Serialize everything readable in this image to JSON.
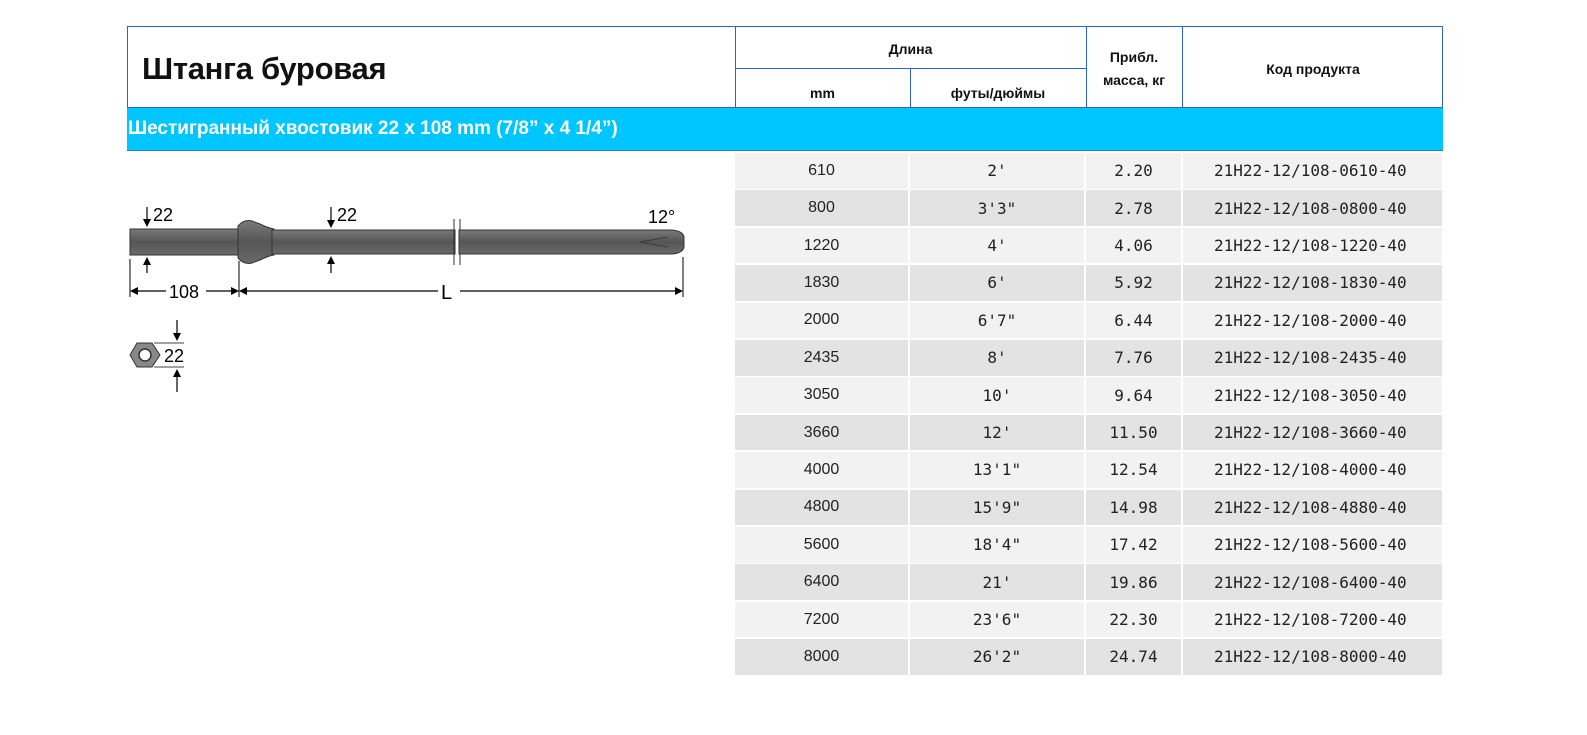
{
  "header": {
    "title": "Штанга буровая",
    "length_group": "Длина",
    "col_mm": "mm",
    "col_ft": "футы/дюймы",
    "col_mass": "Прибл.\nмасса, кг",
    "col_code": "Код продукта"
  },
  "section": {
    "title": "Шестигранный хвостовик 22 x 108 mm (7/8” x 4 1/4”)"
  },
  "drawing": {
    "dim_hex_left": "22",
    "dim_rod": "22",
    "dim_angle": "12°",
    "dim_shank_length": "108",
    "dim_length": "L",
    "dim_hex_section": "22"
  },
  "rows": [
    {
      "mm": "610",
      "ft": "2'",
      "mass": "2.20",
      "code": "21H22-12/108-0610-40"
    },
    {
      "mm": "800",
      "ft": "3'3\"",
      "mass": "2.78",
      "code": "21H22-12/108-0800-40"
    },
    {
      "mm": "1220",
      "ft": "4'",
      "mass": "4.06",
      "code": "21H22-12/108-1220-40"
    },
    {
      "mm": "1830",
      "ft": "6'",
      "mass": "5.92",
      "code": "21H22-12/108-1830-40"
    },
    {
      "mm": "2000",
      "ft": "6'7\"",
      "mass": "6.44",
      "code": "21H22-12/108-2000-40"
    },
    {
      "mm": "2435",
      "ft": "8'",
      "mass": "7.76",
      "code": "21H22-12/108-2435-40"
    },
    {
      "mm": "3050",
      "ft": "10'",
      "mass": "9.64",
      "code": "21H22-12/108-3050-40"
    },
    {
      "mm": "3660",
      "ft": "12'",
      "mass": "11.50",
      "code": "21H22-12/108-3660-40"
    },
    {
      "mm": "4000",
      "ft": "13'1\"",
      "mass": "12.54",
      "code": "21H22-12/108-4000-40"
    },
    {
      "mm": "4800",
      "ft": "15'9\"",
      "mass": "14.98",
      "code": "21H22-12/108-4880-40"
    },
    {
      "mm": "5600",
      "ft": "18'4\"",
      "mass": "17.42",
      "code": "21H22-12/108-5600-40"
    },
    {
      "mm": "6400",
      "ft": "21'",
      "mass": "19.86",
      "code": "21H22-12/108-6400-40"
    },
    {
      "mm": "7200",
      "ft": "23'6\"",
      "mass": "22.30",
      "code": "21H22-12/108-7200-40"
    },
    {
      "mm": "8000",
      "ft": "26'2\"",
      "mass": "24.74",
      "code": "21H22-12/108-8000-40"
    }
  ],
  "colors": {
    "border": "#2f5fd0",
    "band": "#00c6ff",
    "row_light": "#f2f2f2",
    "row_dark": "#e3e3e3",
    "rod": "#5e5e5e"
  }
}
